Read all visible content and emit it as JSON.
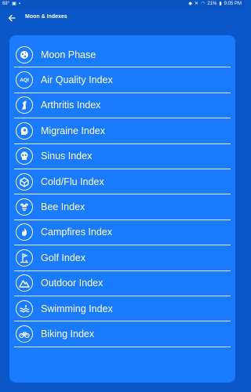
{
  "status_bar": {
    "left_text": "68°",
    "battery_text": "21%",
    "time": "9:05 PM"
  },
  "app_bar": {
    "title": "Moon & Indexes"
  },
  "list": {
    "items": [
      {
        "label": "Moon Phase",
        "icon": "moon-icon"
      },
      {
        "label": "Air Quality Index",
        "icon": "aqi-icon",
        "icon_text": "AQI"
      },
      {
        "label": "Arthritis Index",
        "icon": "arthritis-icon"
      },
      {
        "label": "Migraine Index",
        "icon": "migraine-icon"
      },
      {
        "label": "Sinus Index",
        "icon": "sinus-icon"
      },
      {
        "label": "Cold/Flu Index",
        "icon": "cold-flu-icon"
      },
      {
        "label": "Bee Index",
        "icon": "bee-icon"
      },
      {
        "label": "Campfires Index",
        "icon": "campfire-icon"
      },
      {
        "label": "Golf Index",
        "icon": "golf-icon"
      },
      {
        "label": "Outdoor Index",
        "icon": "mountain-icon"
      },
      {
        "label": "Swimming Index",
        "icon": "swimming-icon"
      },
      {
        "label": "Biking Index",
        "icon": "bike-icon"
      }
    ]
  },
  "colors": {
    "background": "#0b57c9",
    "card": "#1a7bff",
    "text": "#ffffff"
  }
}
